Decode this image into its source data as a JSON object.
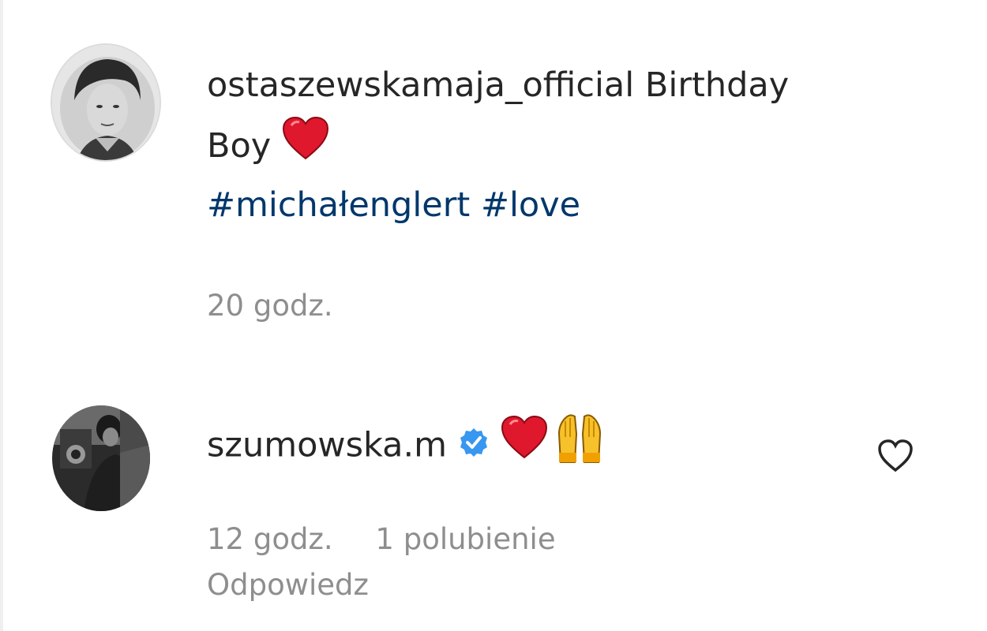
{
  "comments": [
    {
      "username": "ostaszewskamaja_official",
      "text_line1": "Birthday",
      "text_line2": "Boy",
      "emojis": [
        "red-heart"
      ],
      "hashtags": [
        "#michałenglert",
        "#love"
      ],
      "time": "20 godz."
    },
    {
      "username": "szumowska.m",
      "verified": true,
      "emojis": [
        "red-heart",
        "raising-hands"
      ],
      "time": "12 godz.",
      "likes": "1 polubienie",
      "reply_label": "Odpowiedz"
    }
  ],
  "colors": {
    "text": "#262626",
    "hashtag": "#00376b",
    "meta": "#8e8e8e",
    "verified": "#3897f0",
    "heart": "#e0182d"
  }
}
